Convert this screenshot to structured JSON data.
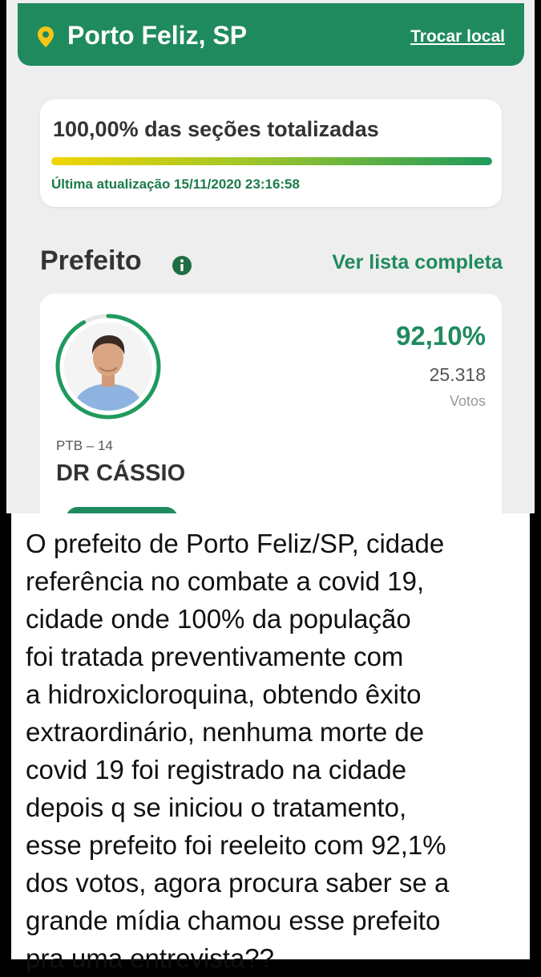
{
  "header": {
    "city": "Porto Feliz, SP",
    "change_location": "Trocar local",
    "icon": "location-pin-icon"
  },
  "progress": {
    "title": "100,00% das seções totalizadas",
    "value_percent": 100,
    "last_update": "Última atualização 15/11/2020 23:16:58"
  },
  "section": {
    "title": "Prefeito",
    "info_icon": "info-icon",
    "full_list": "Ver lista completa"
  },
  "candidate": {
    "percent": "92,10%",
    "votes": "25.318",
    "votes_label": "Votos",
    "party": "PTB – 14",
    "name": "DR CÁSSIO"
  },
  "caption": {
    "lines": [
      "O prefeito de Porto Feliz/SP, cidade",
      "referência no combate a covid 19,",
      "cidade onde 100% da população",
      "foi tratada preventivamente com",
      "a hidroxicloroquina, obtendo êxito",
      "extraordinário, nenhuma morte de",
      "covid 19 foi registrado na cidade",
      "depois q se iniciou o tratamento,",
      "esse prefeito foi reeleito com 92,1%",
      "dos votos, agora procura saber se a",
      "grande mídia chamou esse prefeito",
      "pra uma entrevista??"
    ]
  },
  "colors": {
    "brand_green": "#1f8a5e",
    "progress_start": "#f2d500",
    "progress_end": "#1f9a5d",
    "background": "#000000"
  }
}
